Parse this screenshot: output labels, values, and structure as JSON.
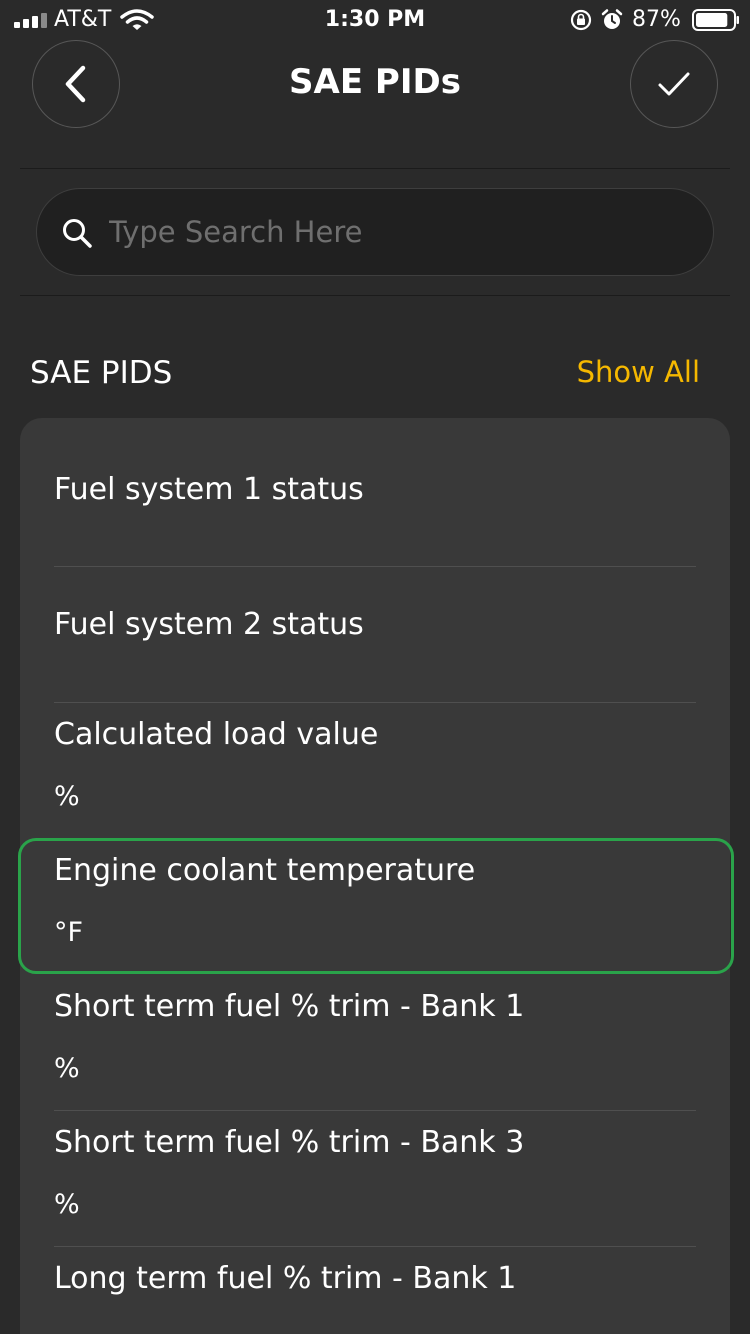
{
  "status_bar": {
    "carrier": "AT&T",
    "time": "1:30 PM",
    "battery": "87%",
    "battery_level": 0.87
  },
  "header": {
    "title": "SAE PIDs",
    "back_icon": "chevron-left-icon",
    "confirm_icon": "checkmark-icon"
  },
  "search": {
    "placeholder": "Type Search Here",
    "value": ""
  },
  "section": {
    "title": "SAE PIDS",
    "show_all": "Show All"
  },
  "pids": [
    {
      "name": "Fuel system 1 status",
      "unit": ""
    },
    {
      "name": "Fuel system 2 status",
      "unit": ""
    },
    {
      "name": "Calculated load value",
      "unit": "%"
    },
    {
      "name": "Engine coolant temperature",
      "unit": "°F",
      "selected": true
    },
    {
      "name": "Short term fuel % trim - Bank 1",
      "unit": "%"
    },
    {
      "name": "Short term fuel % trim - Bank 3",
      "unit": "%"
    },
    {
      "name": "Long term fuel % trim - Bank 1",
      "unit": ""
    }
  ],
  "colors": {
    "background": "#2a2a2a",
    "card": "#393939",
    "accent": "#f5b800",
    "selection": "#2aa34a"
  }
}
